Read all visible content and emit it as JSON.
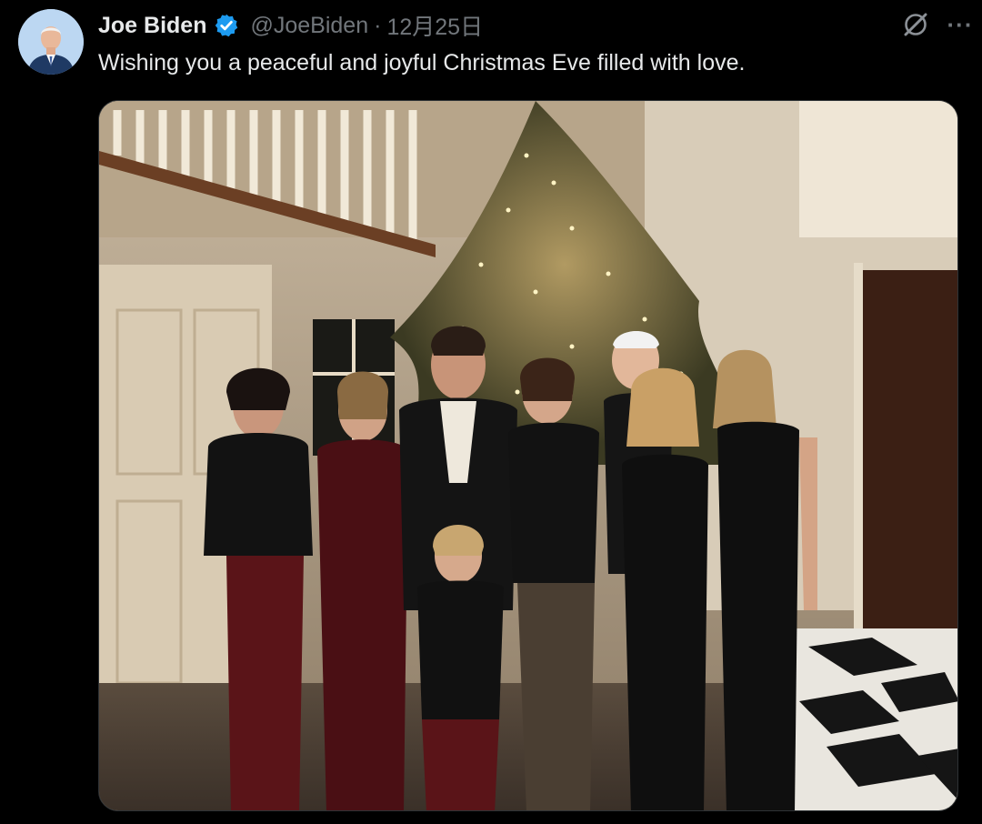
{
  "tweet": {
    "author": {
      "display_name": "Joe Biden",
      "handle": "@JoeBiden",
      "verified_icon": "verified-badge-icon",
      "avatar_icon": "profile-avatar"
    },
    "separator": "·",
    "date": "12月25日",
    "text": "Wishing you a peaceful and joyful Christmas Eve filled with love.",
    "actions": {
      "grok_icon": "grok-icon",
      "more_icon": "more-options-icon",
      "more_label": "···"
    },
    "media": {
      "type": "photo",
      "content": "family-christmas-photo"
    }
  },
  "colors": {
    "background": "#000000",
    "primary_text": "#e7e9ea",
    "secondary_text": "#71767b",
    "verified_blue": "#1d9bf0",
    "border": "#2f3336"
  }
}
